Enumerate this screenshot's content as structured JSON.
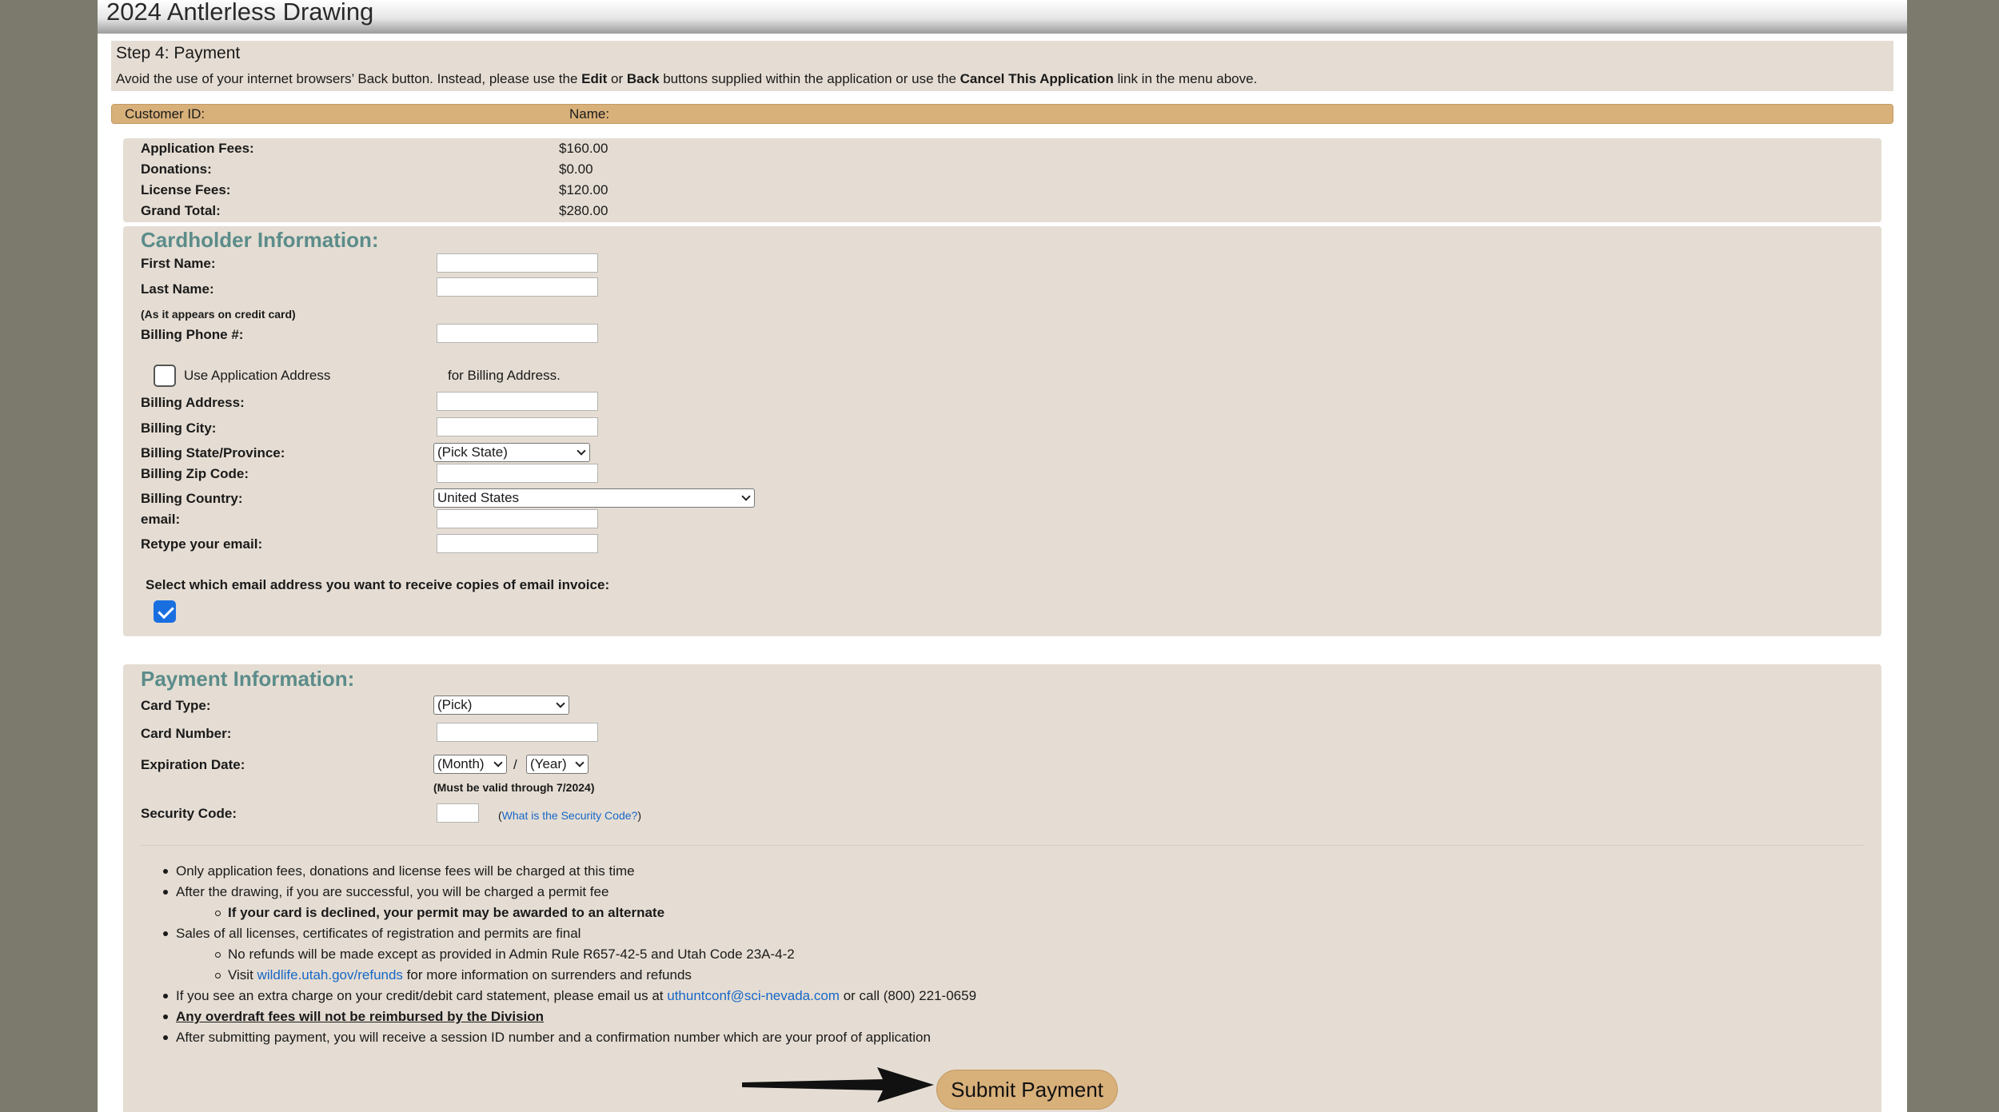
{
  "page": {
    "title": "2024 Antlerless Drawing"
  },
  "step": {
    "title": "Step 4: Payment",
    "note_prefix": "Avoid the use of your internet browsers’ Back button. Instead, please use the",
    "note_edit": "Edit",
    "note_or": "or",
    "note_back": "Back",
    "note_mid": "buttons supplied within the application or use the",
    "note_cancel": "Cancel This Application",
    "note_suffix": "link in the menu above."
  },
  "customer": {
    "id_label": "Customer ID:",
    "name_label": "Name:"
  },
  "fees": [
    {
      "label": "Application Fees",
      "value": "$160.00"
    },
    {
      "label": "Donations",
      "value": "$0.00"
    },
    {
      "label": "License Fees",
      "value": "$120.00"
    },
    {
      "label": "Grand Total",
      "value": "$280.00"
    }
  ],
  "cardholder": {
    "heading": "Cardholder Information:",
    "first_name": "First Name",
    "last_name": "Last Name",
    "credit_note": "(As it appears on credit card)",
    "phone": "Billing Phone #",
    "use_app_address": "Use Application Address",
    "for_billing": "for Billing Address.",
    "address": "Billing Address",
    "city": "Billing City",
    "state": "Billing State/Province",
    "state_value": "(Pick State)",
    "zip": "Billing Zip Code",
    "country": "Billing Country",
    "country_value": "United States",
    "email": "email",
    "retype_email": "Retype your email",
    "email_select": "Select which email address you want to receive copies of email invoice:"
  },
  "payment": {
    "heading": "Payment Information:",
    "card_type": "Card Type",
    "card_type_value": "(Pick)",
    "card_number": "Card Number",
    "expiration": "Expiration Date",
    "month_value": "(Month)",
    "slash": "/",
    "year_value": "(Year)",
    "valid_note": "(Must be valid through 7/2024)",
    "security_code": "Security Code",
    "security_open": "(",
    "security_link": "What is the Security Code?",
    "security_close": ")"
  },
  "notes": {
    "n1": "Only application fees, donations and license fees will be charged at this time",
    "n2": "After the drawing, if you are successful, you will be charged a permit fee",
    "n2a": "If your card is declined, your permit may be awarded to an alternate",
    "n3": "Sales of all licenses, certificates of registration and permits are final",
    "n3a": "No refunds will be made except as provided in Admin Rule R657-42-5 and Utah Code 23A-4-2",
    "n3b_pre": "Visit",
    "n3b_link": "wildlife.utah.gov/refunds",
    "n3b_post": "for more information on surrenders and refunds",
    "n4_pre": "If you see an extra charge on your credit/debit card statement, please email us at",
    "n4_link": "uthuntconf@sci-nevada.com",
    "n4_post": "or call (800) 221-0659",
    "n5": "Any overdraft fees will not be reimbursed by the Division",
    "n6": "After submitting payment, you will receive a session ID number and a confirmation number which are your proof of application"
  },
  "submit": {
    "label": "Submit Payment"
  },
  "colors": {
    "accent": "#d8b07a",
    "heading": "#5b8c8a",
    "panel": "#e5ddd3",
    "link": "#1767c8",
    "checkbox": "#1a6fe0"
  }
}
